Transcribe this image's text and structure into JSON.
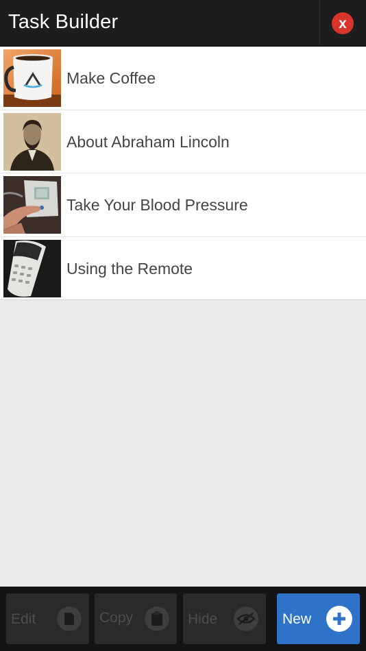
{
  "header": {
    "title": "Task Builder",
    "close_label": "x"
  },
  "tasks": [
    {
      "label": "Make Coffee",
      "thumbnail": "coffee-mug"
    },
    {
      "label": "About Abraham Lincoln",
      "thumbnail": "lincoln-portrait"
    },
    {
      "label": "Take Your Blood Pressure",
      "thumbnail": "blood-pressure-monitor"
    },
    {
      "label": "Using the Remote",
      "thumbnail": "remote-control"
    }
  ],
  "toolbar": {
    "edit_label": "Edit",
    "copy_label": "Copy",
    "hide_label": "Hide",
    "new_label": "New"
  },
  "colors": {
    "header_bg": "#1d1d1d",
    "close": "#d9342b",
    "new_button": "#2f73c9",
    "list_bg": "#ebebeb"
  }
}
